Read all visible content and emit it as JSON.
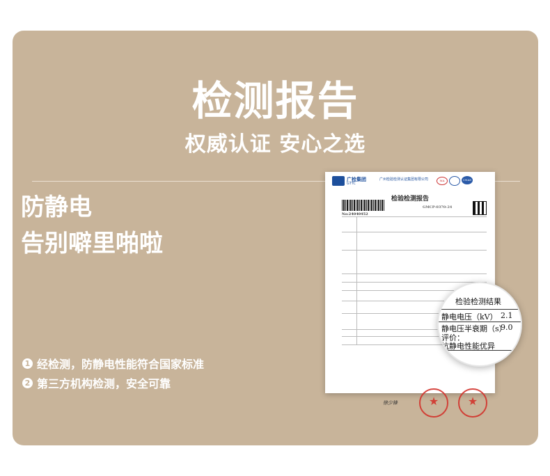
{
  "header": {
    "title": "检测报告",
    "subtitle": "权威认证 安心之选"
  },
  "feature": {
    "line1": "防静电",
    "line2": "告别噼里啪啦"
  },
  "bullets": [
    {
      "num": "1",
      "text": "经检测，防静电性能符合国家标准"
    },
    {
      "num": "2",
      "text": "第三方机构检测，安全可靠"
    }
  ],
  "report": {
    "brand": "广检集团",
    "brand_sub": "GTTC",
    "org_name": "广州检验检测认证集团有限公司",
    "title": "检验检测报告",
    "number": "No:24040452",
    "code": "GMCP-0370-24",
    "cert_ma": "MA",
    "cert_cnas": "CNAS",
    "signature": "徐少锋"
  },
  "magnifier": {
    "title": "检验检测结果",
    "rows": [
      {
        "label": "静电电压（kV）",
        "value": "2.1"
      },
      {
        "label": "静电压半衰期（s）",
        "value": "9.0"
      },
      {
        "label": "评价：",
        "value": ""
      },
      {
        "label": "抗静电性能优异",
        "value": ""
      }
    ]
  }
}
